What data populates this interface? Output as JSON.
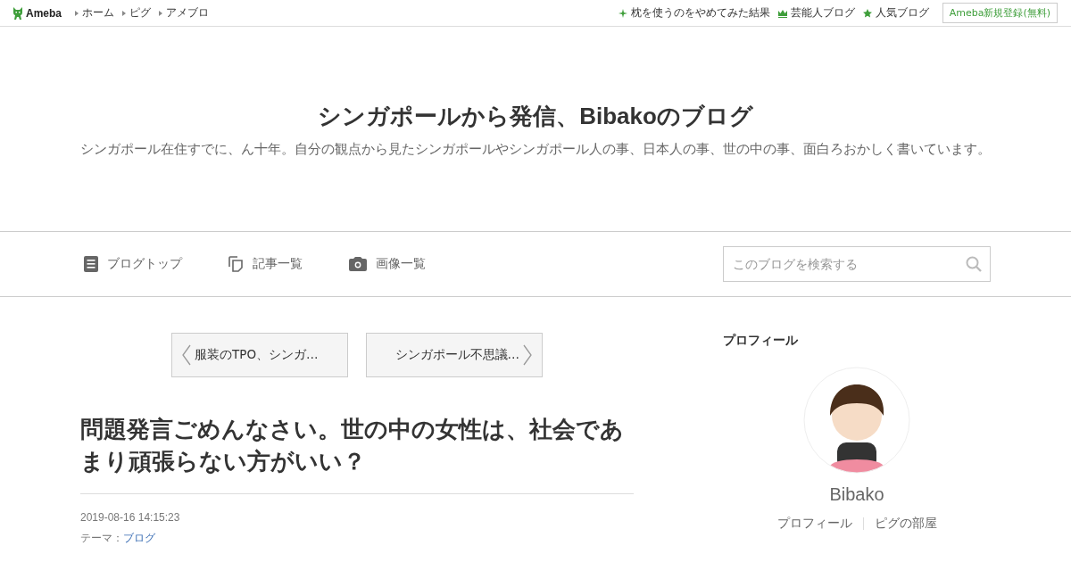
{
  "topbar": {
    "logo": "Ameba",
    "links": [
      "ホーム",
      "ピグ",
      "アメブロ"
    ],
    "right_links": [
      {
        "kind": "sparkle",
        "label": "枕を使うのをやめてみた結果"
      },
      {
        "kind": "crown",
        "label": "芸能人ブログ"
      },
      {
        "kind": "star",
        "label": "人気ブログ"
      }
    ],
    "signup": "Ameba新規登録(無料)"
  },
  "blog": {
    "title": "シンガポールから発信、Bibakoのブログ",
    "description": "シンガポール在住すでに、ん十年。自分の観点から見たシンガポールやシンガポール人の事、日本人の事、世の中の事、面白ろおかしく書いています。"
  },
  "nav": {
    "items": [
      {
        "kind": "doc",
        "label": "ブログトップ"
      },
      {
        "kind": "copy",
        "label": "記事一覧"
      },
      {
        "kind": "camera",
        "label": "画像一覧"
      }
    ],
    "search": {
      "placeholder": "このブログを検索する"
    }
  },
  "pager": {
    "prev": "服装のTPO、シンガ…",
    "next": "シンガポール不思議…"
  },
  "article": {
    "title": "問題発言ごめんなさい。世の中の女性は、社会であまり頑張らない方がいい？",
    "date": "2019-08-16 14:15:23",
    "theme_label": "テーマ：",
    "theme": "ブログ"
  },
  "profile": {
    "heading": "プロフィール",
    "name": "Bibako",
    "links": [
      "プロフィール",
      "ピグの部屋"
    ]
  }
}
